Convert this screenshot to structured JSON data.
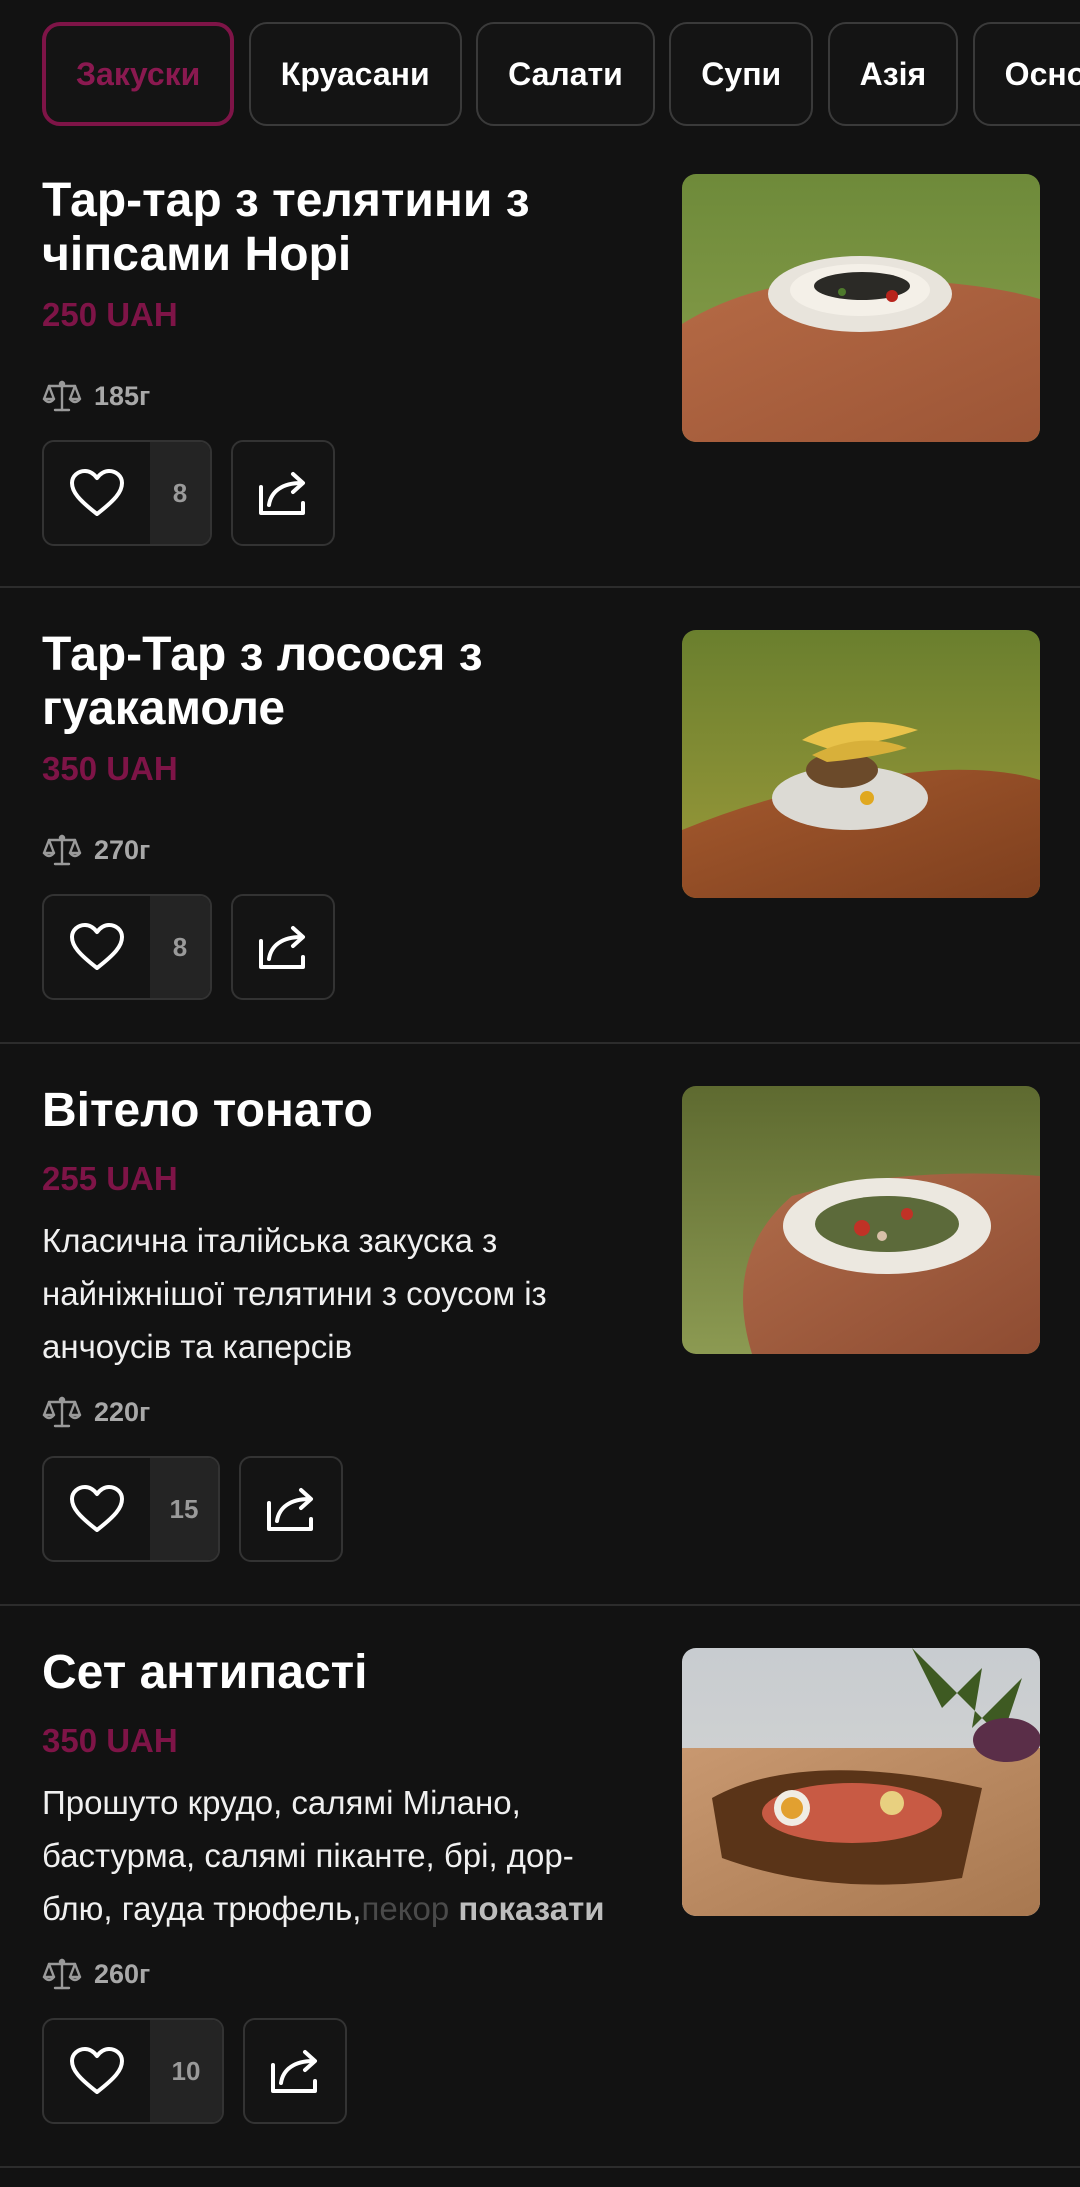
{
  "categories": [
    "Закуски",
    "Круасани",
    "Салати",
    "Супи",
    "Азія",
    "Осно"
  ],
  "active_category": "Закуски",
  "currency": "UAH",
  "accent_color": "#7e1447",
  "items": [
    {
      "title": "Тар-тар з телятини з чіпсами Норі",
      "price": "250 UAH",
      "description": "",
      "weight": "185г",
      "likes": "8"
    },
    {
      "title": "Тар-Тар з лосося з гуакамоле",
      "price": "350 UAH",
      "description": "",
      "weight": "270г",
      "likes": "8"
    },
    {
      "title": "Вітело тонато",
      "price": "255 UAH",
      "description": "Класична італійська закуска з найніжнішої телятини з соусом із анчоусів та каперсів",
      "weight": "220г",
      "likes": "15"
    },
    {
      "title": "Сет антипасті",
      "price": "350 UAH",
      "description": "Прошуто крудо, салямі Мілано, бастурма, салямі піканте, брі, дор-блю, гауда трюфель,",
      "description_fade": "пекор",
      "show_more": "показати",
      "weight": "260г",
      "likes": "10"
    }
  ],
  "icons": {
    "like": "heart-icon",
    "share": "share-icon",
    "weight": "scale-icon"
  }
}
